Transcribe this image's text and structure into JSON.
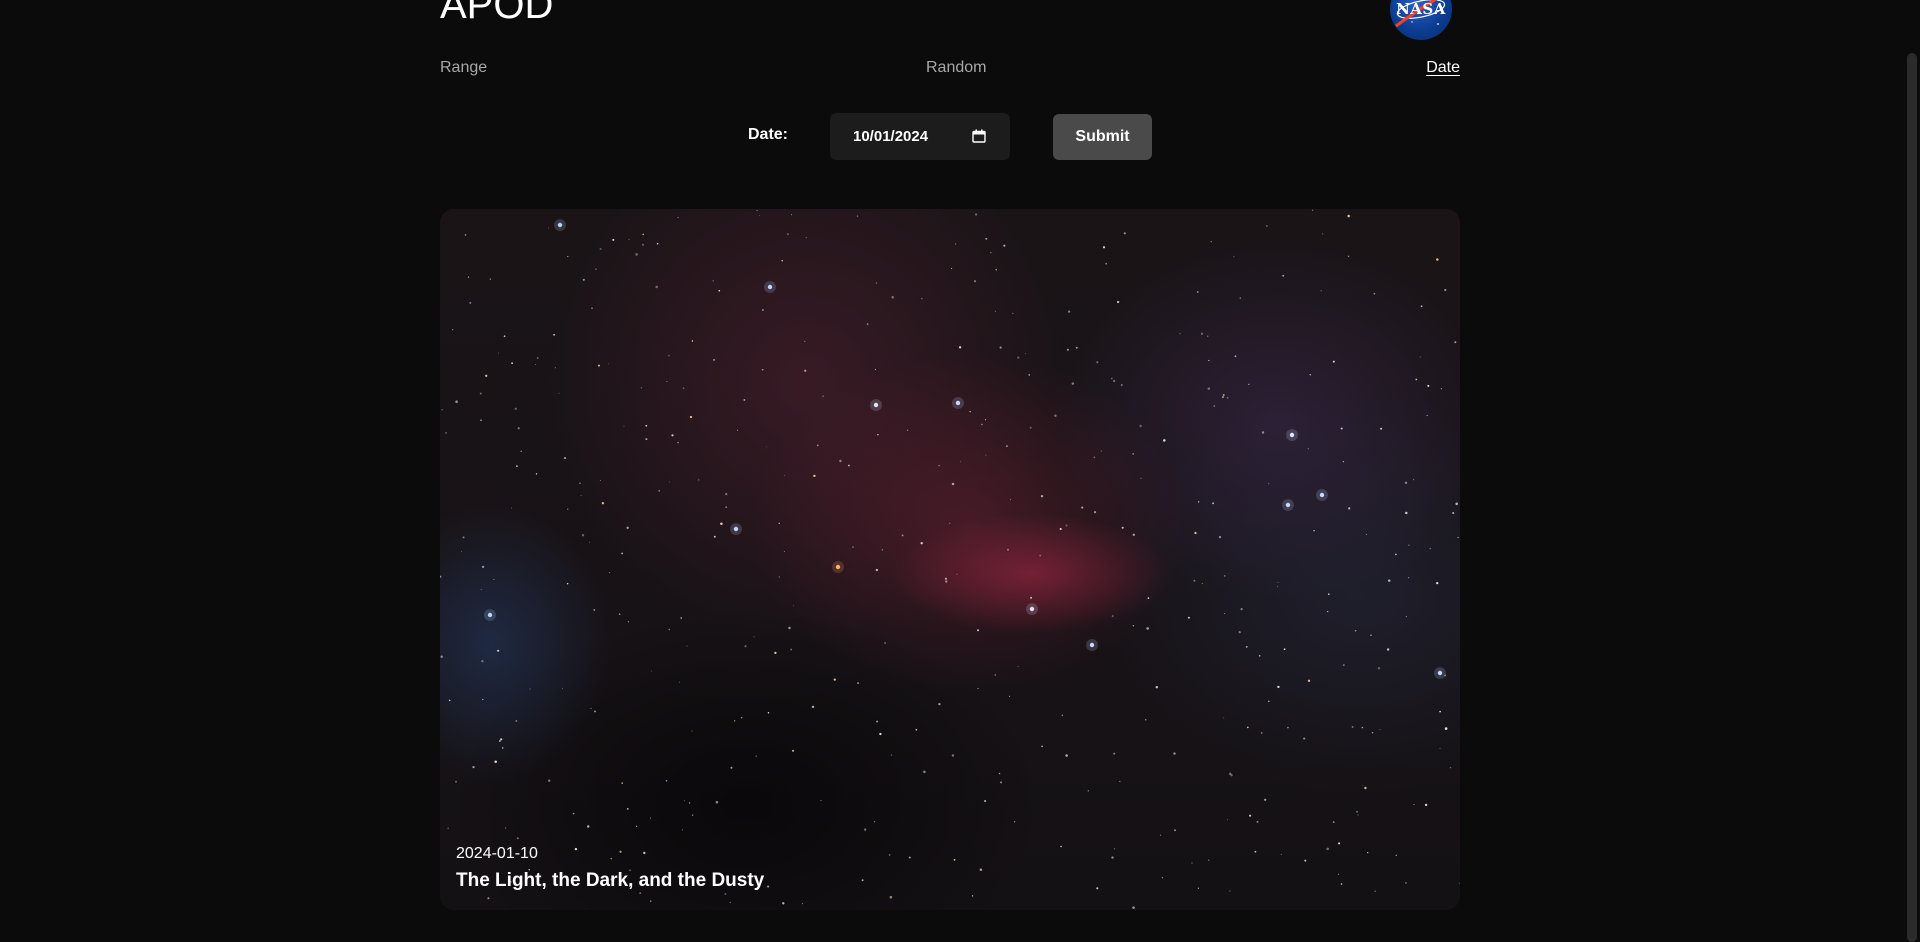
{
  "header": {
    "title": "APOD",
    "logo_text": "NASA"
  },
  "nav": {
    "range": "Range",
    "random": "Random",
    "date": "Date",
    "active": "Date"
  },
  "form": {
    "date_label": "Date:",
    "date_value": "10/01/2024",
    "submit_label": "Submit"
  },
  "apod": {
    "date": "2024-01-10",
    "title": "The Light, the Dark, and the Dusty"
  },
  "icons": {
    "calendar": "calendar-icon",
    "logo": "nasa-logo"
  },
  "colors": {
    "background": "#0b0b0b",
    "input_bg": "#1c1c1c",
    "button_bg": "#4a4a4a",
    "nav_inactive": "#a8a8a8",
    "nav_active": "#ffffff"
  }
}
